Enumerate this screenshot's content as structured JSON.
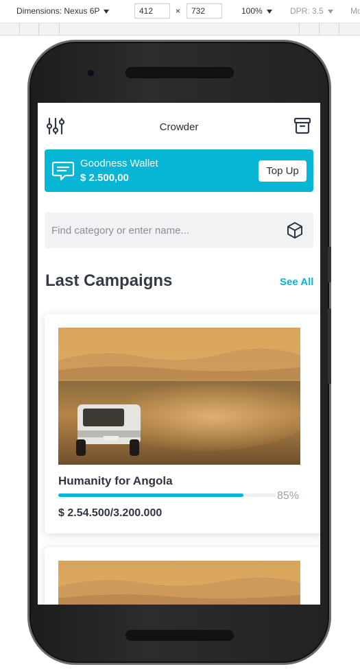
{
  "devtools": {
    "dimensions_label": "Dimensions: Nexus 6P",
    "width_value": "412",
    "times": "×",
    "height_value": "732",
    "zoom": "100%",
    "dpr": "DPR: 3.5",
    "more": "Mo"
  },
  "app": {
    "title": "Crowder",
    "icons": {
      "left": "filter-sliders-icon",
      "right": "archive-icon"
    }
  },
  "wallet": {
    "name": "Goodness Wallet",
    "balance": "$ 2.500,00",
    "button": "Top Up",
    "icon": "message-icon",
    "color": "#06b6d4"
  },
  "search": {
    "placeholder": "Find category or enter name...",
    "icon": "cube-icon"
  },
  "section": {
    "title": "Last Campaigns",
    "link": "See All"
  },
  "campaigns": [
    {
      "title": "Humanity for Angola",
      "progress_percent": 85,
      "progress_label": "85%",
      "amount": "$ 2.54.500/3.200.000",
      "image": "desert-van-photo"
    },
    {
      "image": "desert-photo"
    }
  ]
}
